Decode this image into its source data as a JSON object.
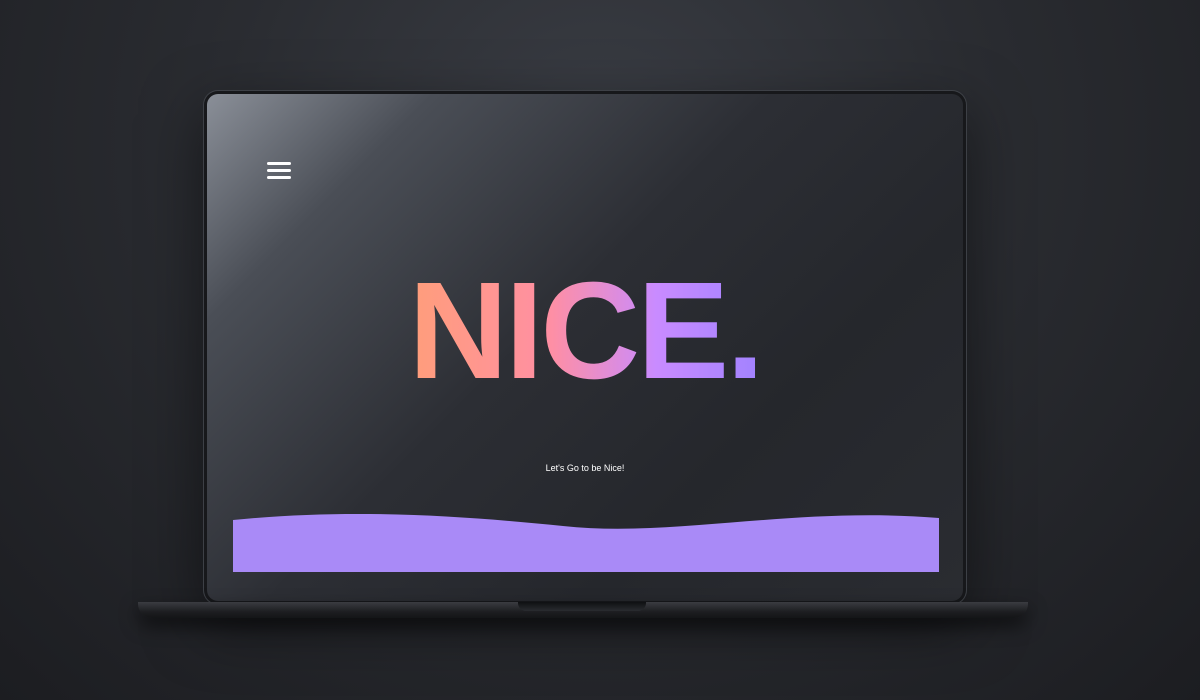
{
  "hero": {
    "title": "NICE.",
    "tagline": "Let's Go to be Nice!"
  },
  "icons": {
    "menu": "hamburger-menu-icon"
  },
  "colors": {
    "gradient_start": "#ff9e7a",
    "gradient_mid": "#ff8fa3",
    "gradient_end": "#a182ff",
    "wave": "#a98af7",
    "screen_bg": "#26282d"
  }
}
